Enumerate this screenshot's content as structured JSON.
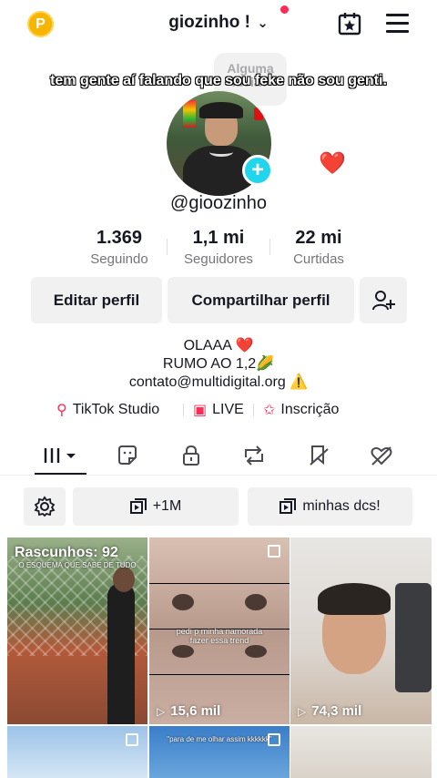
{
  "header": {
    "username": "giozinho !",
    "chevron": "⌄",
    "coin_label": "P",
    "icons": [
      "coin-icon",
      "calendar-star-icon",
      "hamburger-menu-icon"
    ]
  },
  "note": {
    "text": "Alguma ideia?"
  },
  "overlay_caption": "tem gente aí falando que sou feke não sou genti.",
  "profile": {
    "handle": "@gioozinho",
    "add_symbol": "+",
    "heart_sticker": "❤️"
  },
  "stats": [
    {
      "value": "1.369",
      "label": "Seguindo"
    },
    {
      "value": "1,1 mi",
      "label": "Seguidores"
    },
    {
      "value": "22 mi",
      "label": "Curtidas"
    }
  ],
  "actions": {
    "edit": "Editar perfil",
    "share": "Compartilhar perfil",
    "add_friend_icon": "add-friend-icon"
  },
  "bio": {
    "line1": "OLAAA ❤️",
    "line2": "RUMO AO 1,2🌽",
    "line3": "contato@multidigital.org ⚠️"
  },
  "links": [
    {
      "label": "TikTok Studio",
      "icon": "studio-icon"
    },
    {
      "label": "LIVE",
      "icon": "live-icon"
    },
    {
      "label": "Inscrição",
      "icon": "subscription-icon"
    }
  ],
  "tabs": [
    "videos-grid-icon",
    "sticker-icon",
    "lock-icon",
    "repost-icon",
    "favorites-icon",
    "liked-icon"
  ],
  "filters": {
    "settings_icon": "settings-icon",
    "playlist1": "+1M",
    "playlist2": "minhas dcs!"
  },
  "grid": {
    "drafts_label": "Rascunhos: 92",
    "drafts_caption": "O ESQUEMA QUE SABE DE TUDO",
    "cell2_caption": "pedi p minha namorada fazer essa trend",
    "cell2_views": "15,6 mil",
    "cell3_views": "74,3 mil",
    "cell5_caption": "\"para de me olhar assim kkkkkk\"",
    "play_symbol": "▷"
  }
}
